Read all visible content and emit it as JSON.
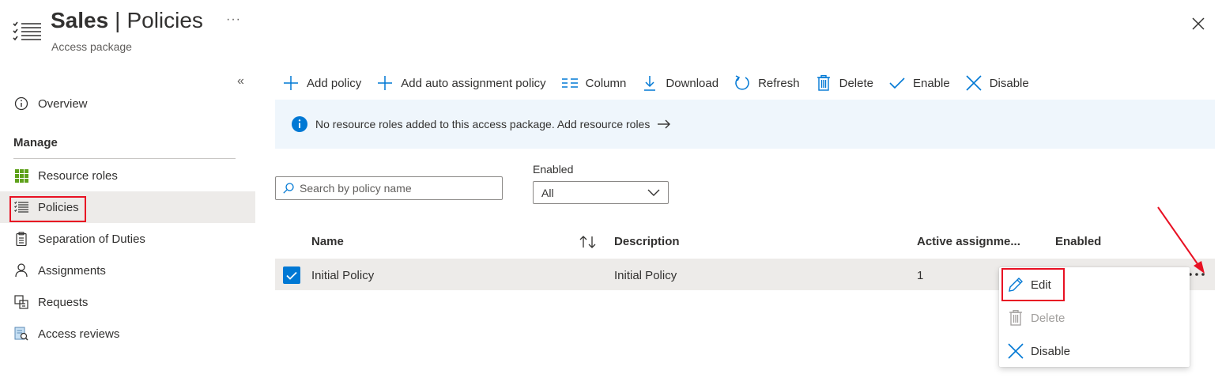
{
  "header": {
    "title_bold": "Sales",
    "title_sep": "|",
    "title_rest": "Policies",
    "subtitle": "Access package",
    "more": "···"
  },
  "sidebar": {
    "overview": "Overview",
    "manage_label": "Manage",
    "items": [
      {
        "label": "Resource roles",
        "icon": "grid-icon"
      },
      {
        "label": "Policies",
        "icon": "checklist-icon"
      },
      {
        "label": "Separation of Duties",
        "icon": "clipboard-icon"
      },
      {
        "label": "Assignments",
        "icon": "person-icon"
      },
      {
        "label": "Requests",
        "icon": "requests-icon"
      },
      {
        "label": "Access reviews",
        "icon": "review-icon"
      }
    ],
    "collapse": "«"
  },
  "toolbar": {
    "add_policy": "Add policy",
    "add_auto": "Add auto assignment policy",
    "column": "Column",
    "download": "Download",
    "refresh": "Refresh",
    "delete": "Delete",
    "enable": "Enable",
    "disable": "Disable"
  },
  "banner": {
    "text": "No resource roles added to this access package. Add resource roles"
  },
  "filters": {
    "search_placeholder": "Search by policy name",
    "enabled_label": "Enabled",
    "enabled_value": "All"
  },
  "table": {
    "columns": [
      "Name",
      "Description",
      "Active assignme...",
      "Enabled"
    ],
    "rows": [
      {
        "name": "Initial Policy",
        "description": "Initial Policy",
        "active": "1",
        "enabled": ""
      }
    ]
  },
  "context_menu": {
    "edit": "Edit",
    "delete": "Delete",
    "disable": "Disable"
  },
  "colors": {
    "accent": "#0078d4",
    "highlight": "#e81123",
    "selected_bg": "#edebe9",
    "banner_bg": "#eff6fc"
  }
}
